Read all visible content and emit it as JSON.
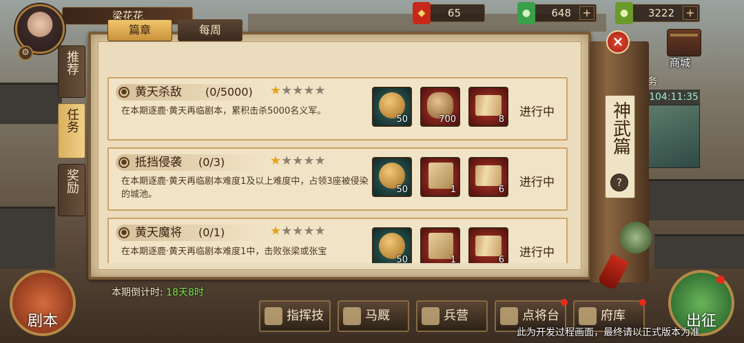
{
  "player": {
    "name": "梁花花"
  },
  "resources": [
    {
      "icon": "token-icon",
      "value": "65",
      "color": "#c8281a"
    },
    {
      "icon": "jade-coin-icon",
      "value": "648",
      "color": "#3aa04a"
    },
    {
      "icon": "jade-coin-icon",
      "value": "3222",
      "color": "#6a9a2a"
    }
  ],
  "store": {
    "label": "商城"
  },
  "event": {
    "title_fragment": "务",
    "timer": "104:11:35"
  },
  "side_tabs": [
    "推荐",
    "任务",
    "奖励"
  ],
  "tabs": [
    "篇章",
    "每周"
  ],
  "chapter_title": "神武篇",
  "help_label": "?",
  "close_label": "×",
  "tasks": [
    {
      "name": "黄天杀敌",
      "progress": "(0/5000)",
      "stars": 1,
      "stars_total": 5,
      "desc": "在本期逐鹿·黄天再临剧本，累积击杀5000名义军。",
      "rewards": [
        {
          "item": "supply-bag",
          "count": "50",
          "bg": "teal"
        },
        {
          "item": "copper-coins",
          "count": "700",
          "bg": "red"
        },
        {
          "item": "scroll",
          "count": "8",
          "bg": "red"
        }
      ],
      "status": "进行中"
    },
    {
      "name": "抵挡侵袭",
      "progress": "(0/3)",
      "stars": 1,
      "stars_total": 5,
      "desc": "在本期逐鹿·黄天再临剧本难度1及以上难度中，占领3座被侵染的城池。",
      "rewards": [
        {
          "item": "supply-bag",
          "count": "50",
          "bg": "teal"
        },
        {
          "item": "book",
          "count": "1",
          "bg": "red"
        },
        {
          "item": "scroll",
          "count": "6",
          "bg": "red"
        }
      ],
      "status": "进行中"
    },
    {
      "name": "黄天魔将",
      "progress": "(0/1)",
      "stars": 1,
      "stars_total": 5,
      "desc": "在本期逐鹿·黄天再临剧本难度1中，击败张梁或张宝",
      "rewards": [
        {
          "item": "supply-bag",
          "count": "50",
          "bg": "teal"
        },
        {
          "item": "book",
          "count": "1",
          "bg": "red"
        },
        {
          "item": "scroll",
          "count": "6",
          "bg": "red"
        }
      ],
      "status": "进行中"
    }
  ],
  "countdown": {
    "label": "本期倒计时:",
    "value": "18天8时"
  },
  "bottom_buttons": [
    {
      "label": "指挥技",
      "icon": "command-icon"
    },
    {
      "label": "马厩",
      "icon": "horse-icon"
    },
    {
      "label": "兵营",
      "icon": "barracks-icon"
    },
    {
      "label": "点将台",
      "icon": "general-stage-icon"
    },
    {
      "label": "府库",
      "icon": "treasury-icon"
    }
  ],
  "script_button": "剧本",
  "march_button": "出征",
  "notice": "此为开发过程画面，最终请以正式版本为准"
}
